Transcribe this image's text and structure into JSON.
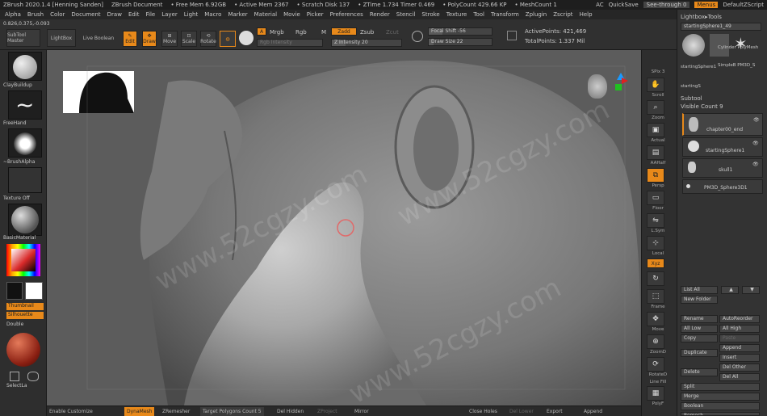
{
  "titlebar": {
    "app": "ZBrush 2020.1.4 [Henning Sanden]",
    "document": "ZBrush Document",
    "free_mem": "• Free Mem 6.92GB",
    "active_mem": "• Active Mem 2367",
    "scratch": "• Scratch Disk 137",
    "ztime": "• ZTime 1.734 Timer 0.469",
    "polycount": "• PolyCount 429.66 KP",
    "meshcount": "• MeshCount 1",
    "ac": "AC",
    "quicksave": "QuickSave",
    "see_through": "See-through 0",
    "menus": "Menus",
    "script": "DefaultZScript"
  },
  "menu": [
    "Alpha",
    "Brush",
    "Color",
    "Document",
    "Draw",
    "Edit",
    "File",
    "Layer",
    "Light",
    "Macro",
    "Marker",
    "Material",
    "Movie",
    "Picker",
    "Preferences",
    "Render",
    "Stencil",
    "Stroke",
    "Texture",
    "Tool",
    "Transform",
    "Zplugin",
    "Zscript",
    "Help"
  ],
  "toolbar": {
    "coords": "0.826,0.375,-0.093",
    "subtool_master": "SubTool Master",
    "lightbox": "LightBox",
    "live_boolean": "Live Boolean",
    "edit": "Edit",
    "draw": "Draw",
    "move": "Move",
    "scale": "Scale",
    "rotate": "Rotate",
    "a_btn": "A",
    "mrgb": "Mrgb",
    "rgb": "Rgb",
    "m": "M",
    "zadd": "Zadd",
    "zsub": "Zsub",
    "zcut": "Zcut",
    "rgb_intensity": "Rgb Intensity",
    "z_intensity": "Z Intensity 20",
    "focal_shift": "Focal Shift -56",
    "draw_size": "Draw Size 22",
    "active_points": "ActivePoints: 421,469",
    "total_points": "TotalPoints: 1.337 Mil"
  },
  "leftshelf": {
    "brush1": "ClayBuildup",
    "stroke": "FreeHand",
    "alpha": "~BrushAlpha",
    "texture": "Texture Off",
    "material": "BasicMaterial",
    "thumbnail": "Thumbnail",
    "silhouette": "Silhouette",
    "double": "Double",
    "selectlasso": "SelectLa"
  },
  "rightshelf": [
    "SPix 3",
    "Scroll",
    "Zoom",
    "Actual",
    "AAHalf",
    "Persp",
    "Floor",
    "L.Sym",
    "Local",
    "Xyz",
    "",
    "Frame",
    "Move",
    "ZoomD",
    "RotateD",
    "Line Fill",
    "PolyF",
    "Transp",
    "Dynamic",
    "Solo"
  ],
  "tray": {
    "header": "Lightbox▸Tools",
    "starting_name": "startingSphere1_49",
    "tool_thumbs": [
      "startingSphere1",
      "Cylinder PolyMesh",
      "SimpleB PM3D_S",
      "startingS"
    ],
    "subtool_header": "Subtool",
    "visible_count": "Visible Count 9",
    "subtools": [
      "chapter00_end",
      "startingSphere1",
      "skull1",
      "PM3D_Sphere3D1"
    ],
    "list_all": "List All",
    "new_folder": "New Folder",
    "rename": "Rename",
    "autoreorder": "AutoReorder",
    "all_low": "All Low",
    "all_high": "All High",
    "copy": "Copy",
    "paste": "Paste",
    "append": "Append",
    "duplicate": "Duplicate",
    "insert": "Insert",
    "delete": "Delete",
    "del_other": "Del Other",
    "del_all": "Del All",
    "split": "Split",
    "merge": "Merge",
    "boolean": "Boolean",
    "remesh": "Remesh"
  },
  "bottombar": {
    "enable_customize": "Enable Customize",
    "dynamesh": "DynaMesh",
    "zremesher": "ZRemesher",
    "target_polys": "Target Polygons Count 5",
    "del_hidden": "Del Hidden",
    "zproject": "ZProject",
    "mirror": "Mirror",
    "close_holes": "Close Holes",
    "del_lower": "Del Lower",
    "export": "Export",
    "append": "Append"
  },
  "watermark": "www.52cgzy.com",
  "colors": {
    "accent": "#e8891a",
    "primary_color": "#d92a2a",
    "secondary_color": "#ffffff"
  }
}
